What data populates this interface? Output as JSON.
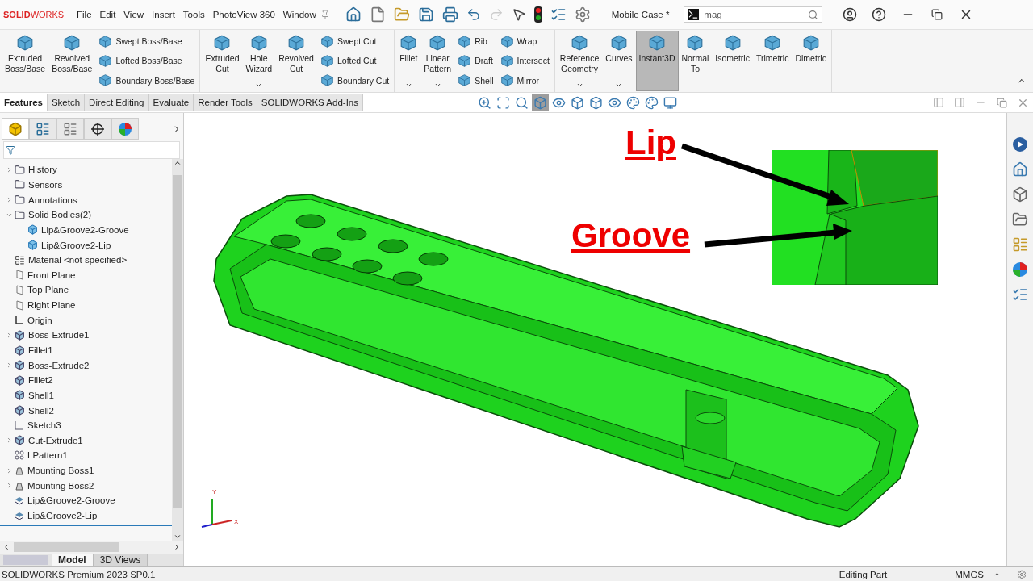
{
  "app": {
    "logo": "**SOLID**WORKS",
    "menus": [
      "File",
      "Edit",
      "View",
      "Insert",
      "Tools",
      "PhotoView 360",
      "Window"
    ],
    "document_title": "Mobile Case *",
    "search": {
      "value": "mag"
    }
  },
  "ribbon": {
    "groups": [
      {
        "columns": [
          {
            "kind": "large",
            "label": "Extruded\nBoss/Base",
            "dropdown": false,
            "selected": false
          },
          {
            "kind": "large",
            "label": "Revolved\nBoss/Base",
            "dropdown": false,
            "selected": false
          },
          {
            "kind": "stack",
            "items": [
              "Swept Boss/Base",
              "Lofted Boss/Base",
              "Boundary Boss/Base"
            ]
          }
        ]
      },
      {
        "columns": [
          {
            "kind": "large",
            "label": "Extruded\nCut",
            "dropdown": false,
            "selected": false
          },
          {
            "kind": "large",
            "label": "Hole\nWizard",
            "dropdown": true,
            "selected": false
          },
          {
            "kind": "large",
            "label": "Revolved\nCut",
            "dropdown": false,
            "selected": false
          },
          {
            "kind": "stack",
            "items": [
              "Swept Cut",
              "Lofted Cut",
              "Boundary Cut"
            ]
          }
        ]
      },
      {
        "columns": [
          {
            "kind": "large",
            "label": "Fillet",
            "dropdown": true,
            "selected": false
          },
          {
            "kind": "large",
            "label": "Linear\nPattern",
            "dropdown": true,
            "selected": false
          },
          {
            "kind": "stack",
            "items": [
              "Rib",
              "Draft",
              "Shell"
            ]
          },
          {
            "kind": "stack",
            "items": [
              "Wrap",
              "Intersect",
              "Mirror"
            ]
          }
        ]
      },
      {
        "columns": [
          {
            "kind": "large",
            "label": "Reference\nGeometry",
            "dropdown": true,
            "selected": false
          },
          {
            "kind": "large",
            "label": "Curves",
            "dropdown": true,
            "selected": false
          },
          {
            "kind": "large",
            "label": "Instant3D",
            "dropdown": false,
            "selected": true
          },
          {
            "kind": "large",
            "label": "Normal\nTo",
            "dropdown": false,
            "selected": false
          },
          {
            "kind": "large",
            "label": "Isometric",
            "dropdown": false,
            "selected": false
          },
          {
            "kind": "large",
            "label": "Trimetric",
            "dropdown": false,
            "selected": false
          },
          {
            "kind": "large",
            "label": "Dimetric",
            "dropdown": false,
            "selected": false
          }
        ]
      }
    ]
  },
  "command_tabs": [
    {
      "label": "Features",
      "selected": true
    },
    {
      "label": "Sketch",
      "selected": false
    },
    {
      "label": "Direct Editing",
      "selected": false
    },
    {
      "label": "Evaluate",
      "selected": false
    },
    {
      "label": "Render Tools",
      "selected": false
    },
    {
      "label": "SOLIDWORKS Add-Ins",
      "selected": false
    }
  ],
  "view_toolbar": [
    {
      "selected": false
    },
    {
      "selected": false
    },
    {
      "selected": false
    },
    {
      "selected": true
    },
    {
      "selected": false
    },
    {
      "selected": false
    },
    {
      "selected": false
    },
    {
      "selected": false
    },
    {
      "selected": false
    },
    {
      "selected": false
    },
    {
      "selected": false
    }
  ],
  "panel_tabs": [
    {
      "selected": true
    },
    {
      "selected": false
    },
    {
      "selected": false
    },
    {
      "selected": false
    },
    {
      "selected": false
    }
  ],
  "feature_tree": {
    "items": [
      {
        "label": "History",
        "kind": "folder",
        "expandable": true,
        "expanded": false
      },
      {
        "label": "Sensors",
        "kind": "folder",
        "expandable": false
      },
      {
        "label": "Annotations",
        "kind": "folder",
        "expandable": true,
        "expanded": false
      },
      {
        "label": "Solid Bodies(2)",
        "kind": "folder",
        "expandable": true,
        "expanded": true,
        "children": [
          {
            "label": "Lip&Groove2-Groove",
            "kind": "body",
            "expandable": false
          },
          {
            "label": "Lip&Groove2-Lip",
            "kind": "body",
            "expandable": false
          }
        ]
      },
      {
        "label": "Material <not specified>",
        "kind": "material",
        "expandable": false
      },
      {
        "label": "Front Plane",
        "kind": "plane",
        "expandable": false
      },
      {
        "label": "Top Plane",
        "kind": "plane",
        "expandable": false
      },
      {
        "label": "Right Plane",
        "kind": "plane",
        "expandable": false
      },
      {
        "label": "Origin",
        "kind": "origin",
        "expandable": false
      },
      {
        "label": "Boss-Extrude1",
        "kind": "feature",
        "expandable": true,
        "expanded": false
      },
      {
        "label": "Fillet1",
        "kind": "feature",
        "expandable": false
      },
      {
        "label": "Boss-Extrude2",
        "kind": "feature",
        "expandable": true,
        "expanded": false
      },
      {
        "label": "Fillet2",
        "kind": "feature",
        "expandable": false
      },
      {
        "label": "Shell1",
        "kind": "feature",
        "expandable": false
      },
      {
        "label": "Shell2",
        "kind": "feature",
        "expandable": false
      },
      {
        "label": "Sketch3",
        "kind": "sketch",
        "expandable": false
      },
      {
        "label": "Cut-Extrude1",
        "kind": "feature",
        "expandable": true,
        "expanded": false
      },
      {
        "label": "LPattern1",
        "kind": "pattern",
        "expandable": false
      },
      {
        "label": "Mounting Boss1",
        "kind": "boss",
        "expandable": true,
        "expanded": false
      },
      {
        "label": "Mounting Boss2",
        "kind": "boss",
        "expandable": true,
        "expanded": false
      },
      {
        "label": "Lip&Groove2-Groove",
        "kind": "lipgroove",
        "expandable": false
      },
      {
        "label": "Lip&Groove2-Lip",
        "kind": "lipgroove",
        "expandable": false
      }
    ]
  },
  "bottom_tabs": [
    {
      "label": "Model",
      "selected": true
    },
    {
      "label": "3D Views",
      "selected": false
    }
  ],
  "viewport": {
    "callouts": [
      {
        "label": "Lip"
      },
      {
        "label": "Groove"
      }
    ],
    "triad": [
      "Y",
      "X"
    ]
  },
  "status_bar": {
    "product": "SOLIDWORKS Premium 2023 SP0.1",
    "mode": "Editing Part",
    "units": "MMGS"
  }
}
